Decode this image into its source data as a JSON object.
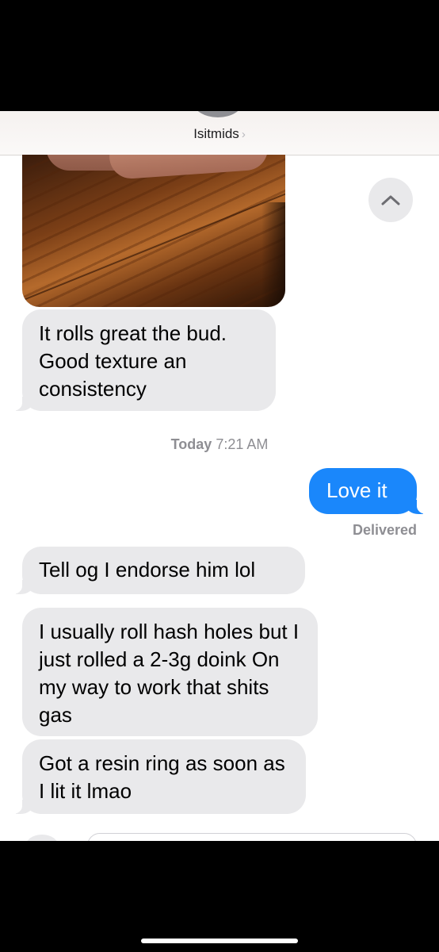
{
  "header": {
    "contact_name": "Isitmids",
    "chevron": "›"
  },
  "messages": {
    "m1": "It rolls great the bud. Good texture an consistency",
    "m2": "Love it",
    "m3": "Tell og I endorse him lol",
    "m4": "I usually roll hash holes but I just rolled a 2-3g doink On my way to work that shits gas",
    "m5": "Got a resin ring as soon as I lit it lmao"
  },
  "timestamp": {
    "day": "Today",
    "time": "7:21 AM"
  },
  "status": {
    "delivered": "Delivered"
  },
  "colors": {
    "sent_bubble": "#1a87fb",
    "received_bubble": "#e9e9eb",
    "meta_text": "#8e8e93"
  },
  "icons": {
    "scroll_up": "chevron-up-icon",
    "contact_chevron": "chevron-right-icon"
  }
}
